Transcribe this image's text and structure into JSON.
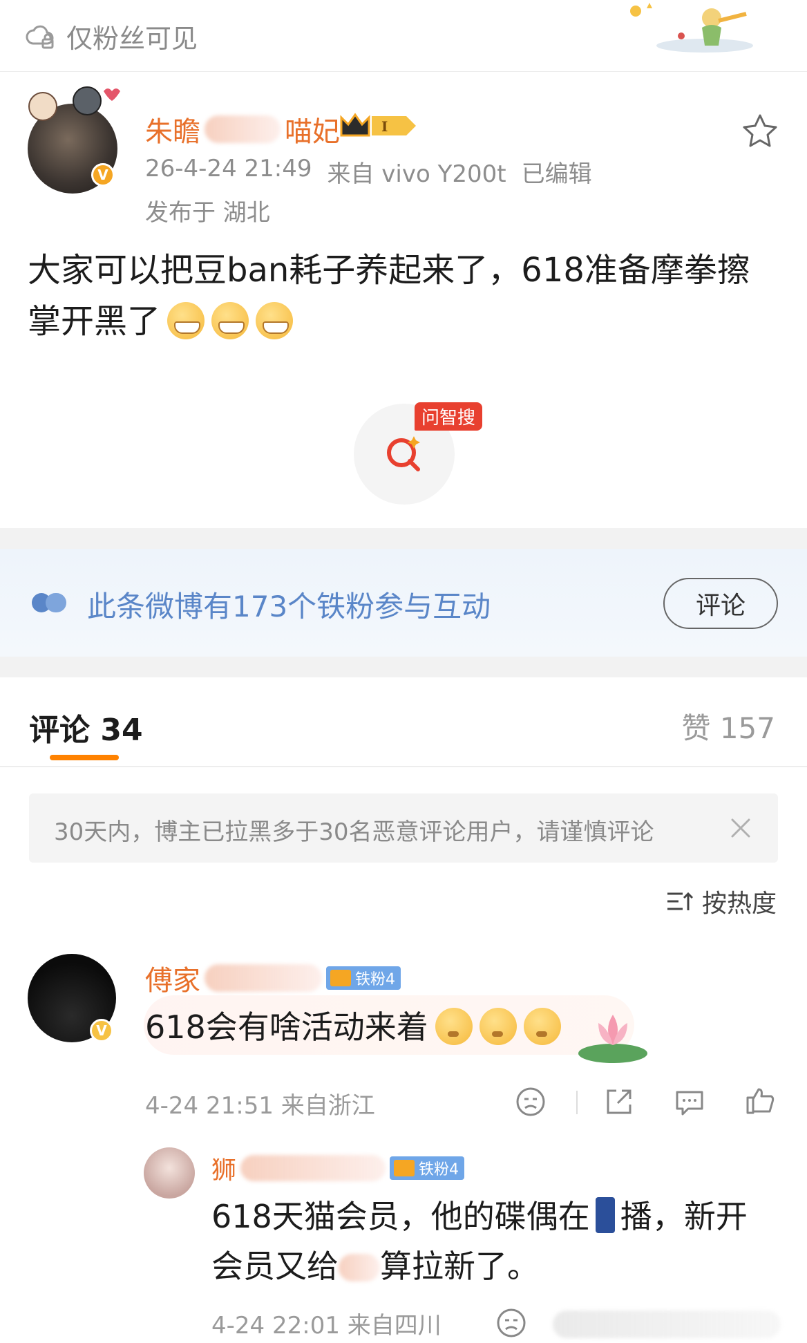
{
  "header": {
    "privacy_label": "仅粉丝可见"
  },
  "post": {
    "author_visible": "朱瞻",
    "author_tail": "喵妃",
    "timestamp": "26-4-24 21:49",
    "source": "来自 vivo Y200t",
    "edited": "已编辑",
    "location": "发布于 湖北",
    "body": "大家可以把豆ban耗子养起来了，618准备摩拳擦掌开黑了",
    "emoji_count_icon": "grinning-emoji"
  },
  "ask": {
    "tag": "问智搜"
  },
  "fan_bar": {
    "text": "此条微博有173个铁粉参与互动",
    "button": "评论"
  },
  "tabs": {
    "comments_label": "评论",
    "comments_count": "34",
    "likes_label": "赞",
    "likes_count": "157"
  },
  "notice": {
    "text": "30天内，博主已拉黑多于30名恶意评论用户，请谨慎评论"
  },
  "sort": {
    "label": "按热度"
  },
  "comment1": {
    "name_visible": "傅家",
    "badge": "铁粉4",
    "text": "618会有啥活动来着",
    "meta": "4-24 21:51  来自浙江"
  },
  "reply1": {
    "name_visible": "狮",
    "badge": "铁粉4",
    "text_part1": "618天猫会员，他的碟偶在",
    "text_part2": "播，新开会员又给",
    "text_part3": "算拉新了。",
    "meta": "4-24 22:01  来自四川"
  },
  "colors": {
    "accent_orange": "#ff8200",
    "name_orange": "#e8702a",
    "fan_blue": "#5a86c8",
    "ask_red": "#e8402f"
  }
}
